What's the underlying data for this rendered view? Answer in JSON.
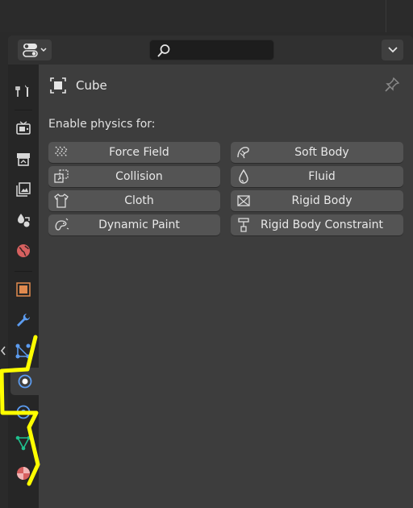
{
  "header": {
    "search_value": "",
    "search_placeholder": ""
  },
  "object": {
    "name": "Cube"
  },
  "physics": {
    "section_label": "Enable physics for:",
    "buttons": [
      {
        "label": "Force Field",
        "icon": "force-field-icon"
      },
      {
        "label": "Soft Body",
        "icon": "soft-body-icon"
      },
      {
        "label": "Collision",
        "icon": "collision-icon"
      },
      {
        "label": "Fluid",
        "icon": "fluid-icon"
      },
      {
        "label": "Cloth",
        "icon": "cloth-icon"
      },
      {
        "label": "Rigid Body",
        "icon": "rigid-body-icon"
      },
      {
        "label": "Dynamic Paint",
        "icon": "dynamic-paint-icon"
      },
      {
        "label": "Rigid Body Constraint",
        "icon": "rigid-body-constraint-icon"
      }
    ]
  },
  "tabs": [
    {
      "name": "tool",
      "icon": "tool-icon"
    },
    {
      "name": "render",
      "icon": "render-icon"
    },
    {
      "name": "output",
      "icon": "output-icon"
    },
    {
      "name": "view-layer",
      "icon": "view-layer-icon"
    },
    {
      "name": "scene",
      "icon": "scene-icon"
    },
    {
      "name": "world",
      "icon": "world-icon"
    },
    {
      "name": "object",
      "icon": "object-icon"
    },
    {
      "name": "modifiers",
      "icon": "wrench-icon"
    },
    {
      "name": "particles",
      "icon": "particles-icon"
    },
    {
      "name": "physics",
      "icon": "physics-icon",
      "active": true
    },
    {
      "name": "constraints",
      "icon": "constraints-icon"
    },
    {
      "name": "data",
      "icon": "mesh-data-icon"
    },
    {
      "name": "material",
      "icon": "material-icon"
    }
  ],
  "colors": {
    "accent_blue": "#5c9cf0",
    "object_orange": "#e08a4f",
    "world_red": "#d6605f",
    "mesh_green": "#1fc08d",
    "annotation_yellow": "#ffff00"
  }
}
